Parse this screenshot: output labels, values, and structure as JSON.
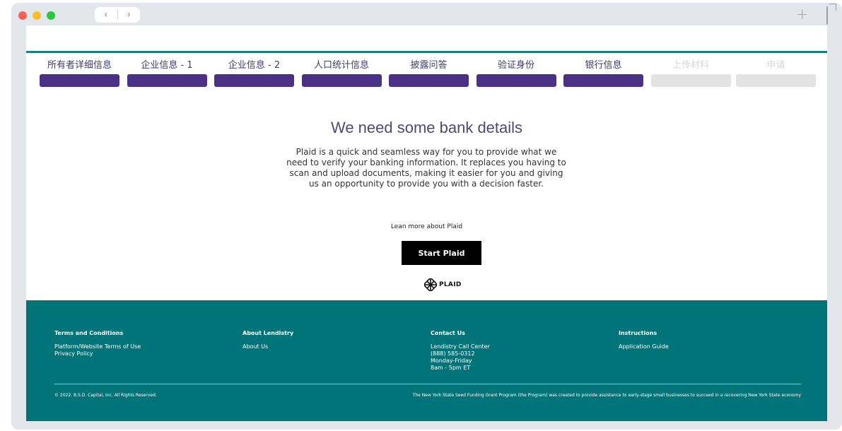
{
  "browser": {
    "back_glyph": "‹",
    "forward_glyph": "›",
    "new_tab_glyph": "+"
  },
  "steps": [
    {
      "label": "所有者详细信息",
      "status": "complete"
    },
    {
      "label": "企业信息 - 1",
      "status": "complete"
    },
    {
      "label": "企业信息 - 2",
      "status": "complete"
    },
    {
      "label": "人口统计信息",
      "status": "complete"
    },
    {
      "label": "披露问答",
      "status": "complete"
    },
    {
      "label": "验证身份",
      "status": "complete"
    },
    {
      "label": "银行信息",
      "status": "complete"
    },
    {
      "label": "上传材料",
      "status": "inactive"
    },
    {
      "label": "申请",
      "status": "inactive"
    }
  ],
  "colors": {
    "accent": "#4a3186",
    "teal": "#007478",
    "inactive_bar": "#e3e3e3"
  },
  "main": {
    "heading": "We need some bank details",
    "description": "Plaid is a quick and seamless way for you to provide what we need to verify your banking information. It replaces you having to scan and upload documents, making it easier for you and giving us an opportunity to provide you with a decision faster.",
    "learn_more": "Lean more about Plaid",
    "start_button": "Start Plaid",
    "logo_text": "PLAID"
  },
  "footer": {
    "columns": [
      {
        "heading": "Terms and Conditions",
        "links": [
          "Platform/Website Terms of Use",
          "Privacy Policy"
        ]
      },
      {
        "heading": "About Lendistry",
        "links": [
          "About Us"
        ]
      },
      {
        "heading": "Contact Us",
        "links": [
          "Lendistry Call Center",
          "(888) 585-0312",
          "Monday-Friday",
          "8am - 5pm ET"
        ]
      },
      {
        "heading": "Instructions",
        "links": [
          "Application Guide"
        ]
      }
    ],
    "copyright": "© 2022. B.S.D. Capital, Inc. All Rights Reserved.",
    "program_note": "The New York State Seed Funding Grant Program (the Program) was created to provide assistance to early-stage small businesses to succeed in a recovering New York State economy"
  }
}
